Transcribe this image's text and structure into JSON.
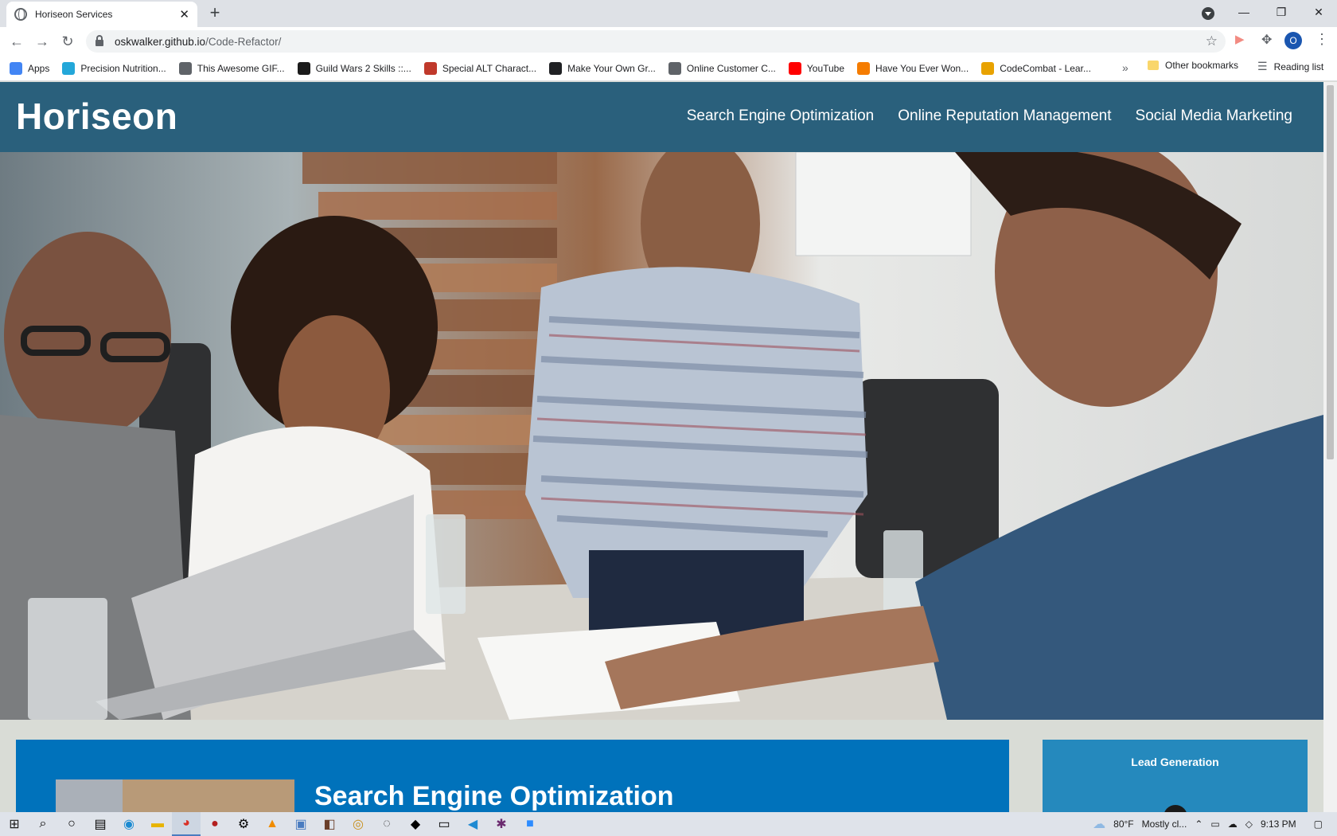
{
  "browser": {
    "tab_title": "Horiseon Services",
    "url_host": "oskwalker.github.io",
    "url_path": "/Code-Refactor/",
    "profile_initial": "O",
    "bookmarks": [
      {
        "label": "Apps",
        "icon": "apps-grid-icon",
        "color": "#4285f4"
      },
      {
        "label": "Precision Nutrition...",
        "icon": "pn-icon",
        "color": "#23a7d9"
      },
      {
        "label": "This Awesome GIF...",
        "icon": "globe-icon",
        "color": "#5f6368"
      },
      {
        "label": "Guild Wars 2 Skills ::...",
        "icon": "gw2-icon",
        "color": "#1b1b1b"
      },
      {
        "label": "Special ALT Charact...",
        "icon": "alt-icon",
        "color": "#c0392b"
      },
      {
        "label": "Make Your Own Gr...",
        "icon": "rocket-icon",
        "color": "#202124"
      },
      {
        "label": "Online Customer C...",
        "icon": "globe-icon",
        "color": "#5f6368"
      },
      {
        "label": "YouTube",
        "icon": "youtube-icon",
        "color": "#ff0000"
      },
      {
        "label": "Have You Ever Won...",
        "icon": "up-icon",
        "color": "#f57c00"
      },
      {
        "label": "CodeCombat - Lear...",
        "icon": "codecombat-icon",
        "color": "#e8a200"
      }
    ],
    "more_label": "»",
    "other_bookmarks": "Other bookmarks",
    "reading_list": "Reading list"
  },
  "site": {
    "logo": "Horiseon",
    "nav": [
      "Search Engine Optimization",
      "Online Reputation Management",
      "Social Media Marketing"
    ],
    "content_title": "Search Engine Optimization",
    "aside_title": "Lead Generation"
  },
  "taskbar": {
    "weather": "80°F",
    "weather_desc": "Mostly cl...",
    "time": "9:13 PM"
  },
  "colors": {
    "header": "#2a607c",
    "content": "#0072bb",
    "aside": "#2589bd",
    "page_bg": "#d9dcd6"
  }
}
